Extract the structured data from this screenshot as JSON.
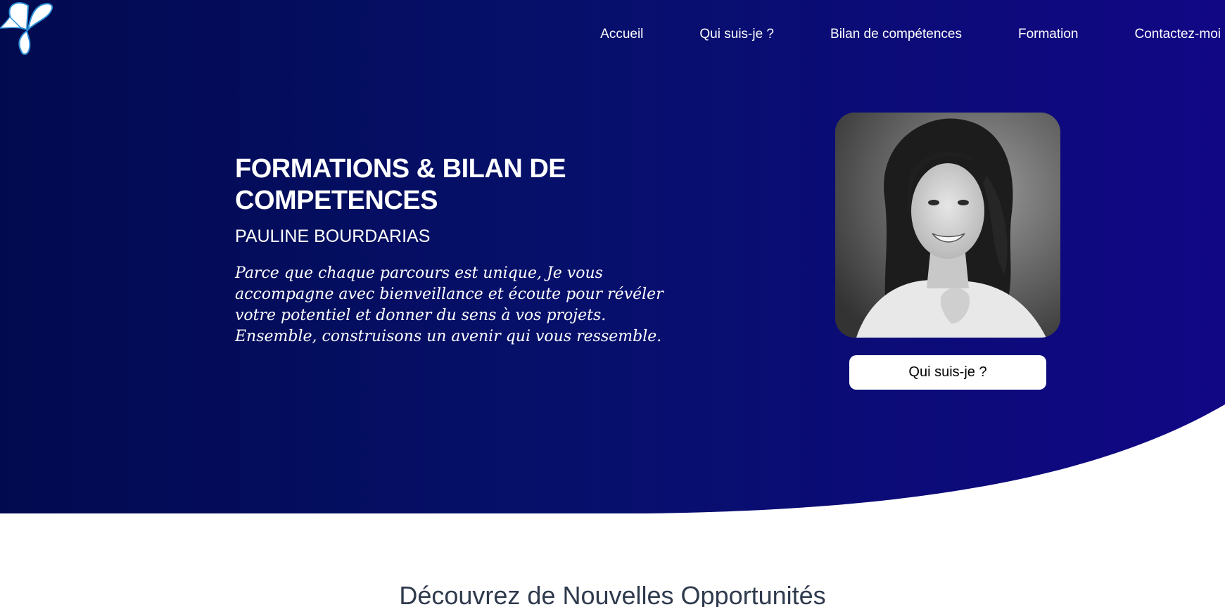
{
  "nav": {
    "items": [
      {
        "label": "Accueil"
      },
      {
        "label": "Qui suis-je ?"
      },
      {
        "label": "Bilan de compétences"
      },
      {
        "label": "Formation"
      },
      {
        "label": "Contactez-moi"
      }
    ]
  },
  "hero": {
    "title": "FORMATIONS & BILAN DE COMPETENCES",
    "subtitle": "PAULINE BOURDARIAS",
    "description": "Parce que chaque parcours est unique, Je vous accompagne avec bienveillance et écoute pour révéler votre potentiel et donner du sens à vos projets. Ensemble, construisons un avenir qui vous ressemble.",
    "cta_label": "Qui suis-je ?"
  },
  "section": {
    "heading": "Découvrez de Nouvelles Opportunités"
  },
  "colors": {
    "hero_start": "#020a4f",
    "hero_end": "#110785",
    "heading_text": "#2f3a4d"
  }
}
